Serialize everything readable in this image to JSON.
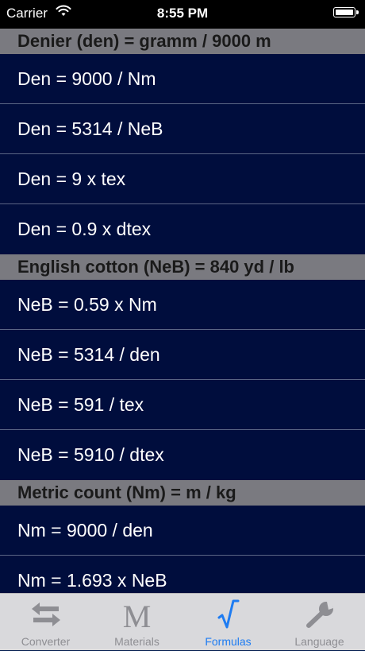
{
  "status_bar": {
    "carrier": "Carrier",
    "time": "8:55 PM"
  },
  "sections": [
    {
      "header": "Denier (den) = gramm / 9000 m",
      "rows": [
        "Den = 9000 / Nm",
        "Den = 5314 / NeB",
        "Den = 9 x tex",
        "Den = 0.9 x dtex"
      ]
    },
    {
      "header": "English cotton (NeB) = 840 yd / lb",
      "rows": [
        "NeB = 0.59 x Nm",
        "NeB = 5314 / den",
        "NeB = 591 / tex",
        "NeB = 5910 / dtex"
      ]
    },
    {
      "header": "Metric count (Nm) = m / kg",
      "rows": [
        "Nm = 9000 / den",
        "Nm = 1.693 x NeB"
      ]
    }
  ],
  "tabs": [
    {
      "label": "Converter",
      "icon": "arrows-icon"
    },
    {
      "label": "Materials",
      "icon": "m-letter-icon"
    },
    {
      "label": "Formulas",
      "icon": "square-root-icon",
      "active": true
    },
    {
      "label": "Language",
      "icon": "wrench-icon"
    }
  ],
  "colors": {
    "accent": "#1e7cf2",
    "row_bg": "#000d3d",
    "header_bg": "#7a7a80"
  }
}
